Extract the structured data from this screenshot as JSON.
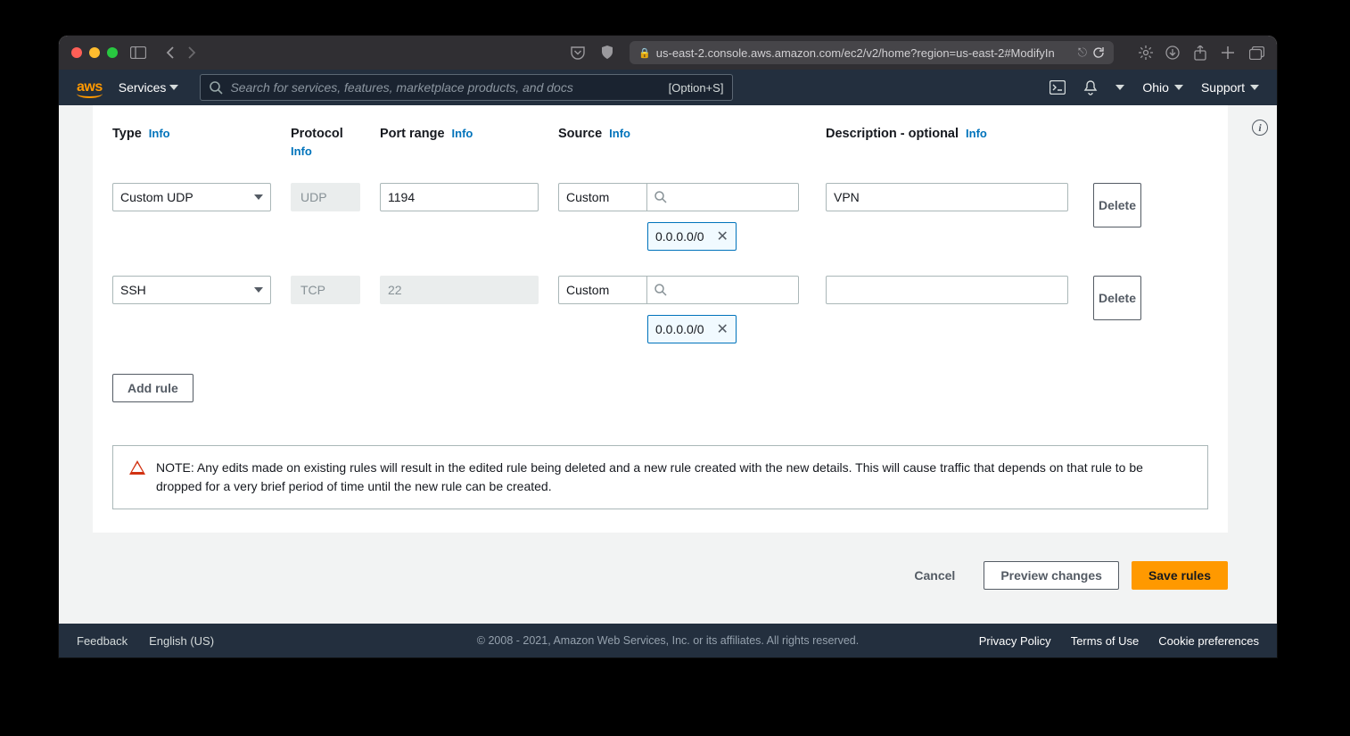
{
  "browser": {
    "url": "us-east-2.console.aws.amazon.com/ec2/v2/home?region=us-east-2#ModifyIn"
  },
  "awsHeader": {
    "services": "Services",
    "searchPlaceholder": "Search for services, features, marketplace products, and docs",
    "searchShortcut": "[Option+S]",
    "region": "Ohio",
    "support": "Support"
  },
  "columns": {
    "type": "Type",
    "protocol": "Protocol",
    "port": "Port range",
    "source": "Source",
    "description": "Description - optional",
    "info": "Info"
  },
  "rules": [
    {
      "type": "Custom UDP",
      "protocol": "UDP",
      "port": "1194",
      "portDisabled": false,
      "sourceMode": "Custom",
      "cidr": "0.0.0.0/0",
      "description": "VPN"
    },
    {
      "type": "SSH",
      "protocol": "TCP",
      "port": "22",
      "portDisabled": true,
      "sourceMode": "Custom",
      "cidr": "0.0.0.0/0",
      "description": ""
    }
  ],
  "buttons": {
    "delete": "Delete",
    "addRule": "Add rule",
    "cancel": "Cancel",
    "preview": "Preview changes",
    "save": "Save rules"
  },
  "warning": "NOTE: Any edits made on existing rules will result in the edited rule being deleted and a new rule created with the new details. This will cause traffic that depends on that rule to be dropped for a very brief period of time until the new rule can be created.",
  "footer": {
    "feedback": "Feedback",
    "language": "English (US)",
    "copyright": "© 2008 - 2021, Amazon Web Services, Inc. or its affiliates. All rights reserved.",
    "privacy": "Privacy Policy",
    "terms": "Terms of Use",
    "cookie": "Cookie preferences"
  }
}
